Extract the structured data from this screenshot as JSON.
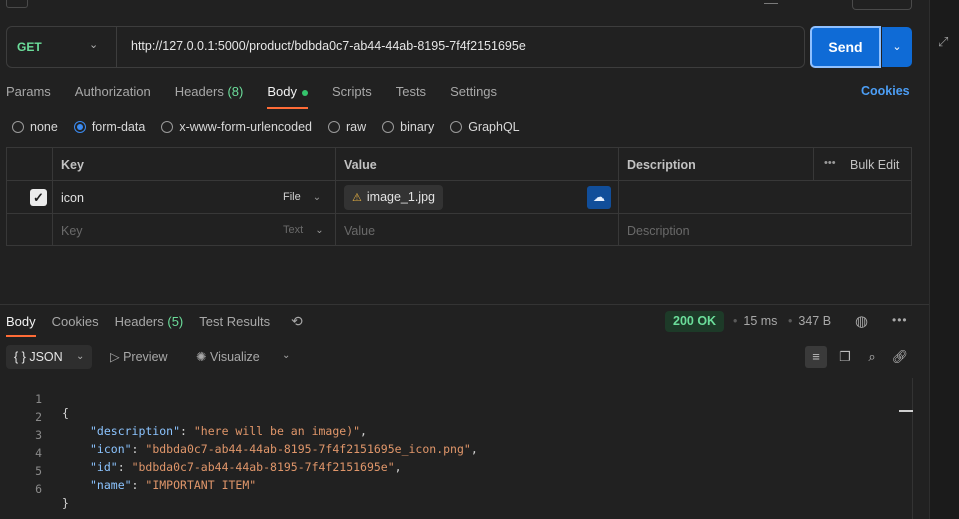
{
  "request": {
    "method": "GET",
    "url": "http://127.0.0.1:5000/product/bdbda0c7-ab44-44ab-8195-7f4f2151695e",
    "send_label": "Send"
  },
  "tabs": {
    "params": "Params",
    "authorization": "Authorization",
    "headers": "Headers",
    "headers_count": "(8)",
    "body": "Body",
    "scripts": "Scripts",
    "tests": "Tests",
    "settings": "Settings",
    "cookies": "Cookies"
  },
  "body_types": {
    "none": "none",
    "form_data": "form-data",
    "urlencoded": "x-www-form-urlencoded",
    "raw": "raw",
    "binary": "binary",
    "graphql": "GraphQL",
    "selected": "form-data"
  },
  "form_table": {
    "headers": {
      "key": "Key",
      "value": "Value",
      "description": "Description",
      "bulk_edit": "Bulk Edit"
    },
    "row": {
      "key": "icon",
      "type": "File",
      "file": "image_1.jpg",
      "checked": true
    },
    "empty": {
      "key": "Key",
      "type": "Text",
      "value": "Value",
      "description": "Description"
    }
  },
  "response": {
    "tabs": {
      "body": "Body",
      "cookies": "Cookies",
      "headers": "Headers",
      "headers_count": "(5)",
      "test_results": "Test Results"
    },
    "status": "200 OK",
    "time": "15 ms",
    "size": "347 B",
    "format": "JSON",
    "preview": "Preview",
    "visualize": "Visualize",
    "lines": [
      "1",
      "2",
      "3",
      "4",
      "5",
      "6"
    ],
    "json": {
      "open": "{",
      "close": "}",
      "description_key": "\"description\"",
      "description_val": "\"here will be an image)\"",
      "icon_key": "\"icon\"",
      "icon_val": "\"bdbda0c7-ab44-44ab-8195-7f4f2151695e_icon.png\"",
      "id_key": "\"id\"",
      "id_val": "\"bdbda0c7-ab44-44ab-8195-7f4f2151695e\"",
      "name_key": "\"name\"",
      "name_val": "\"IMPORTANT ITEM\""
    }
  },
  "icons": {
    "expand": "expand-icon",
    "history": "history-icon",
    "globe": "globe-icon",
    "more": "more-icon",
    "wrap": "wrap-lines-icon",
    "copy": "copy-icon",
    "search": "search-icon",
    "link": "link-icon",
    "upload": "cloud-upload-icon",
    "warning": "warning-icon"
  },
  "colors": {
    "accent": "#ff6c37",
    "send": "#0f6bd6",
    "method_get": "#6bdd9a",
    "status_ok": "#6bdd9a",
    "link": "#4c9ef5"
  }
}
